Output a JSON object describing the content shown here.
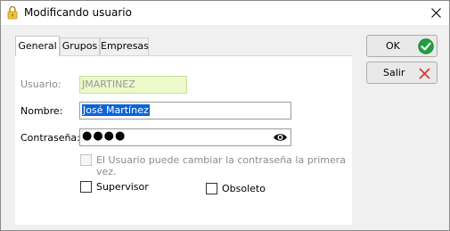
{
  "window": {
    "title": "Modificando usuario"
  },
  "tabs": [
    {
      "label": "General",
      "active": true
    },
    {
      "label": "Grupos",
      "active": false
    },
    {
      "label": "Empresas",
      "active": false
    }
  ],
  "form": {
    "usuario_label": "Usuario:",
    "usuario_value": "JMARTINEZ",
    "nombre_label": "Nombre:",
    "nombre_value": "José Martínez",
    "contrasena_label": "Contraseña:",
    "contrasena_mask": "●●●●",
    "cambiar_label": "El Usuario puede cambiar la contraseña la primera vez.",
    "supervisor_label": "Supervisor",
    "obsoleto_label": "Obsoleto"
  },
  "buttons": {
    "ok_label": "OK",
    "salir_label": "Salir"
  },
  "colors": {
    "selection": "#0a64d8",
    "readonly_field": "#ecf9c8",
    "ok_icon": "#20a040",
    "salir_icon": "#d23a3a"
  },
  "icons": {
    "title": "lock-icon",
    "close": "close-icon",
    "password_toggle": "eye-icon",
    "ok": "checkmark-icon",
    "salir": "cancel-x-icon"
  }
}
